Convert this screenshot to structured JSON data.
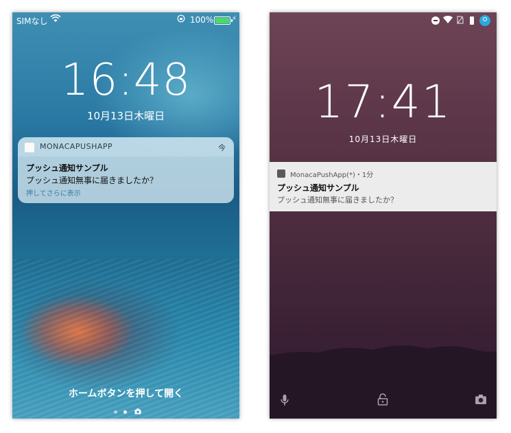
{
  "ios": {
    "status": {
      "carrier": "SIMなし",
      "battery_percent": "100%",
      "wifi_icon": "wifi-icon",
      "lock_icon": "rotation-lock-icon"
    },
    "time": "16:48",
    "date": "10月13日木曜日",
    "notification": {
      "app_name": "MONACAPUSHAPP",
      "time": "今",
      "title": "プッシュ通知サンプル",
      "body": "プッシュ通知無事に届きましたか？",
      "hint": "押してさらに表示"
    },
    "home_hint": "ホームボタンを押して開く",
    "colors": {
      "battery": "#4cd964"
    }
  },
  "android": {
    "time": "17:41",
    "date": "10月13日木曜日",
    "notification": {
      "app_line": "MonacaPushApp(*)・1分",
      "title": "プッシュ通知サンプル",
      "body": "プッシュ通知無事に届きましたか？"
    },
    "bottom_icons": [
      "microphone-icon",
      "lock-icon",
      "camera-icon"
    ],
    "colors": {
      "user_avatar": "#29a9e0"
    }
  }
}
